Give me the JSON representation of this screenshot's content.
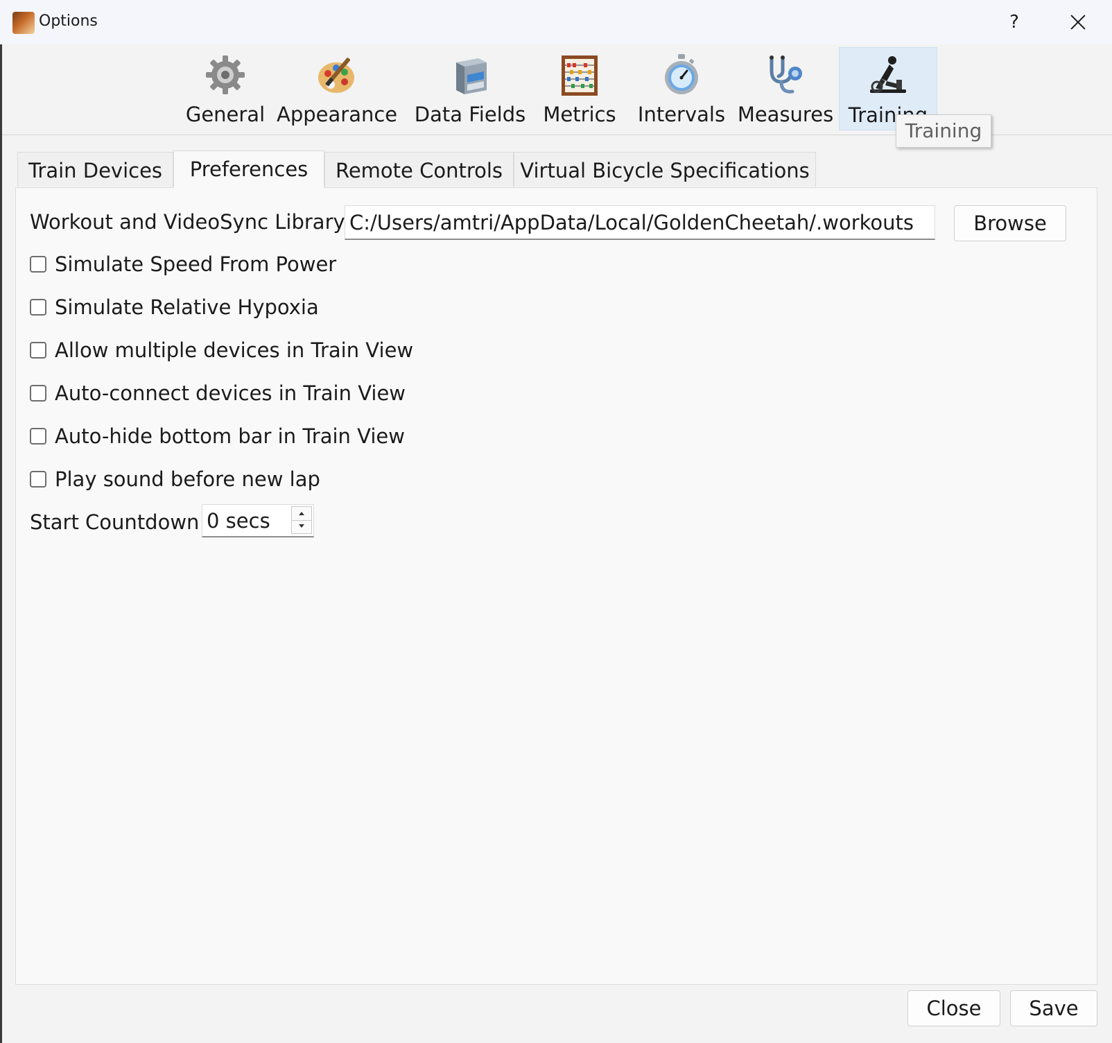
{
  "window": {
    "title": "Options",
    "help_label": "?"
  },
  "toolbar": {
    "items": [
      {
        "label": "General",
        "icon": "gear-icon"
      },
      {
        "label": "Appearance",
        "icon": "palette-icon"
      },
      {
        "label": "Data Fields",
        "icon": "file-cabinet-icon"
      },
      {
        "label": "Metrics",
        "icon": "abacus-icon"
      },
      {
        "label": "Intervals",
        "icon": "stopwatch-icon"
      },
      {
        "label": "Measures",
        "icon": "stethoscope-icon"
      },
      {
        "label": "Training",
        "icon": "trainer-icon"
      }
    ],
    "active": "Training",
    "tooltip": "Training"
  },
  "tabs": {
    "items": [
      "Train Devices",
      "Preferences",
      "Remote Controls",
      "Virtual Bicycle Specifications"
    ],
    "active": "Preferences"
  },
  "preferences": {
    "library_label": "Workout and VideoSync Library",
    "library_path": "C:/Users/amtri/AppData/Local/GoldenCheetah/.workouts",
    "browse_label": "Browse",
    "checkboxes": [
      {
        "label": "Simulate Speed From Power",
        "checked": false
      },
      {
        "label": "Simulate Relative Hypoxia",
        "checked": false
      },
      {
        "label": "Allow multiple devices in Train View",
        "checked": false
      },
      {
        "label": "Auto-connect devices in Train View",
        "checked": false
      },
      {
        "label": "Auto-hide bottom bar in Train View",
        "checked": false
      },
      {
        "label": "Play sound before new lap",
        "checked": false
      }
    ],
    "countdown_label": "Start Countdown",
    "countdown_value": "0 secs"
  },
  "footer": {
    "close_label": "Close",
    "save_label": "Save"
  }
}
